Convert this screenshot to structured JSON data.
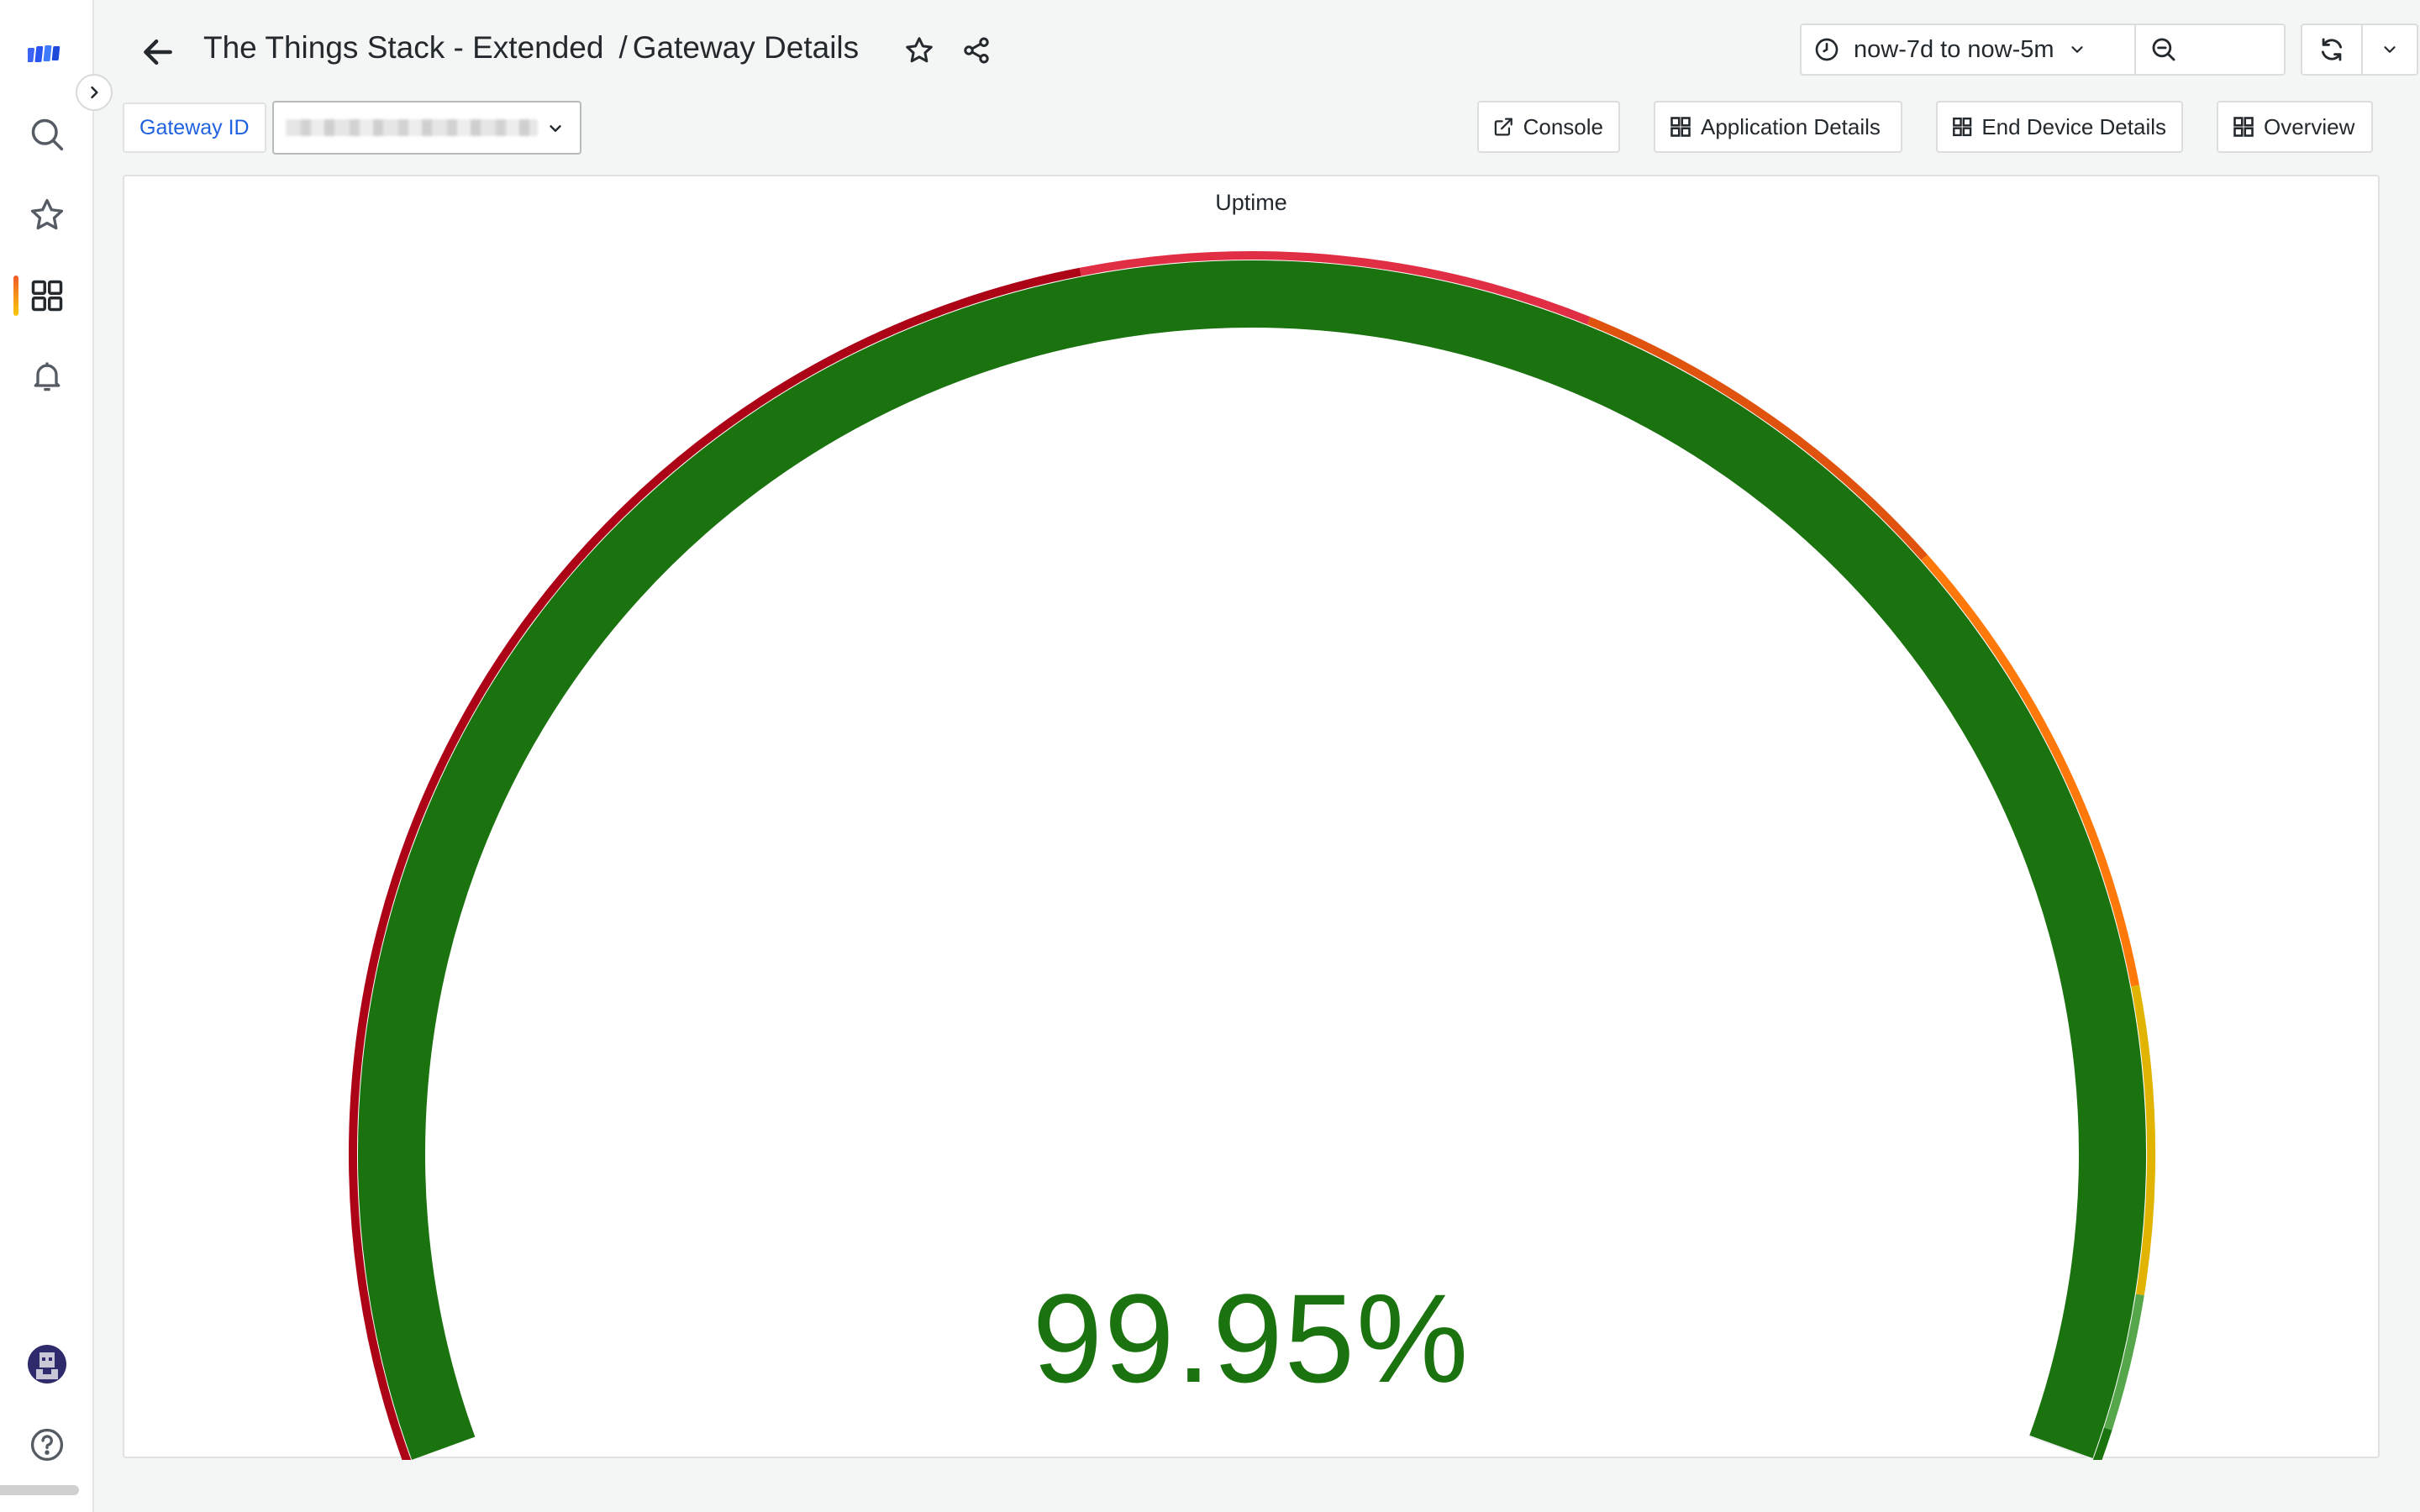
{
  "header": {
    "title": "The Things Stack - Extended",
    "separator": "/",
    "subtitle": "Gateway Details"
  },
  "time_picker": {
    "range": "now-7d to now-5m"
  },
  "variables": {
    "gateway_label": "Gateway ID"
  },
  "links": {
    "console": "Console",
    "application_details": "Application Details",
    "end_device_details": "End Device Details",
    "overview": "Overview"
  },
  "panel": {
    "title": "Uptime",
    "value_text": "99.95%"
  },
  "gauge": {
    "value": 99.95,
    "fill_color": "#1b730f",
    "thresholds": [
      {
        "from": 0,
        "to": 45,
        "color": "#ad0317"
      },
      {
        "from": 45,
        "to": 60,
        "color": "#e02f44"
      },
      {
        "from": 60,
        "to": 72,
        "color": "#e0530f"
      },
      {
        "from": 72,
        "to": 86,
        "color": "#ff780a"
      },
      {
        "from": 86,
        "to": 95,
        "color": "#e0b400"
      },
      {
        "from": 95,
        "to": 99,
        "color": "#56a64b"
      },
      {
        "from": 99,
        "to": 100,
        "color": "#1b730f"
      }
    ]
  },
  "colors": {
    "accent": "#1f62e0",
    "success": "#1b730f"
  },
  "icons": {
    "logo": "grafana-logo-icon",
    "search": "search-icon",
    "starred": "star-icon",
    "dashboards": "dashboards-grid-icon",
    "alerting": "bell-icon",
    "profile": "avatar-icon",
    "help": "help-icon"
  }
}
